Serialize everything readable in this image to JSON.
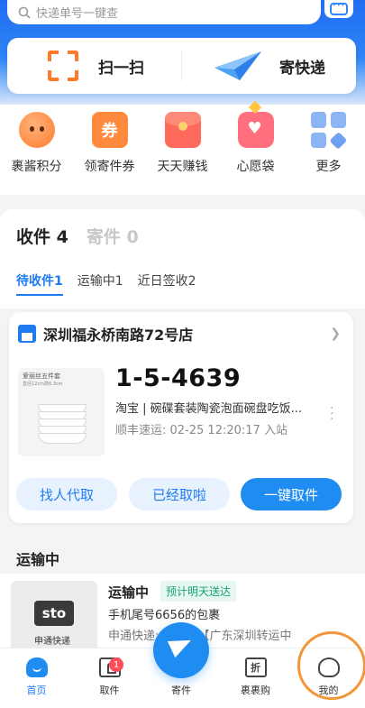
{
  "search": {
    "placeholder": "快递单号一键查"
  },
  "quick_actions": [
    {
      "label": "扫一扫",
      "icon": "scan-icon"
    },
    {
      "label": "寄快递",
      "icon": "paper-plane-icon"
    }
  ],
  "services": [
    {
      "label": "裹酱积分",
      "icon": "mascot-face-icon"
    },
    {
      "label": "领寄件券",
      "icon": "coupon-icon",
      "glyph": "券"
    },
    {
      "label": "天天赚钱",
      "icon": "red-packet-icon"
    },
    {
      "label": "心愿袋",
      "icon": "wish-bag-icon"
    },
    {
      "label": "更多",
      "icon": "more-grid-icon"
    }
  ],
  "tabs": {
    "receive": "收件 4",
    "send": "寄件 0"
  },
  "subtabs": [
    {
      "label": "待收件1",
      "active": true
    },
    {
      "label": "运输中1",
      "active": false
    },
    {
      "label": "近日签收2",
      "active": false
    }
  ],
  "pickup_card": {
    "store": "深圳福永桥南路72号店",
    "thumb_title": "爱丽丝五件套",
    "thumb_sub": "直径12cm高6.3cm",
    "code": "1-5-4639",
    "description": "淘宝 | 碗碟套装陶瓷泡面碗盘吃饭...",
    "status": "顺丰速运: 02-25 12:20:17 入站",
    "buttons": [
      "找人代取",
      "已经取啦",
      "一键取件"
    ]
  },
  "transit_section": {
    "title": "运输中",
    "logo_text": "sto",
    "logo_sub": "申通快递",
    "status": "运输中",
    "badge": "预计明天送达",
    "desc": "手机尾号6656的包裹",
    "info": "申通快递: 快件由【广东深圳转运中"
  },
  "tabbar": [
    {
      "label": "首页",
      "icon": "home-icon",
      "active": true
    },
    {
      "label": "取件",
      "icon": "pickup-icon",
      "badge": "1"
    },
    {
      "label": "寄件",
      "icon": "send-plane-icon"
    },
    {
      "label": "裹裹购",
      "icon": "shop-bag-icon",
      "glyph": "折"
    },
    {
      "label": "我的",
      "icon": "profile-icon"
    }
  ],
  "colors": {
    "accent": "#1f8cf2",
    "highlight_ring": "#f5953a"
  }
}
